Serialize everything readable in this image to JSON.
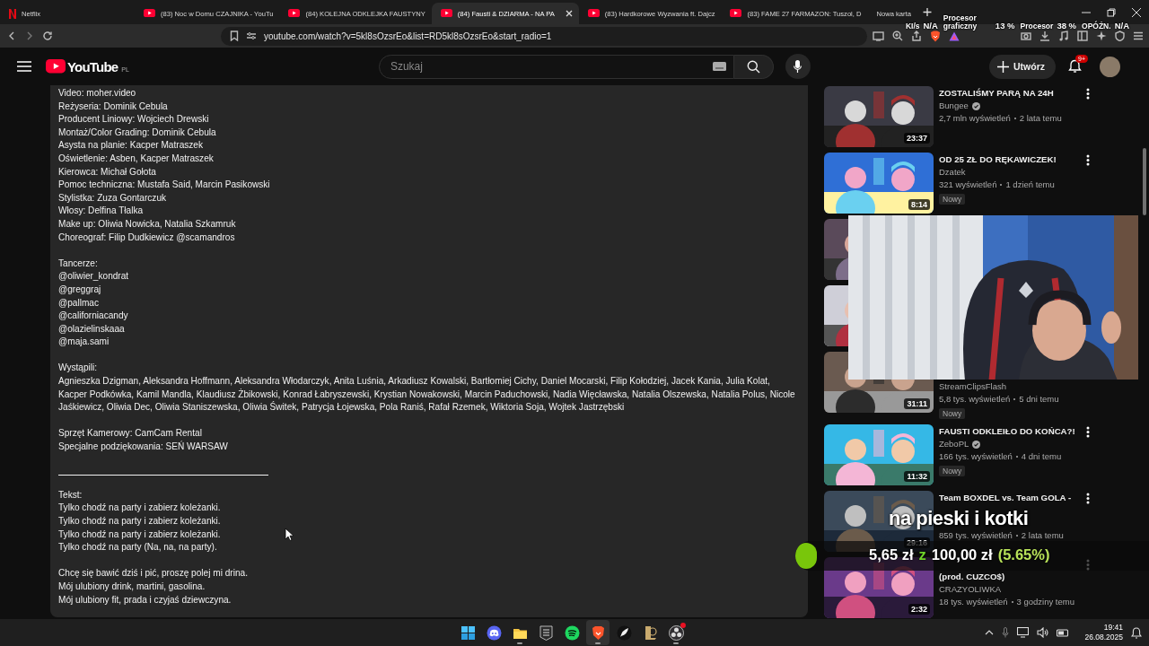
{
  "browser": {
    "tabs": [
      {
        "kind": "netflix",
        "title": "Netflix",
        "selected": false
      },
      {
        "kind": "youtube",
        "title": "(83) Noc w Domu CZAJNIKA - YouTu",
        "selected": false
      },
      {
        "kind": "youtube",
        "title": "(84) KOLEJNA ODKLEJKA FAUSTYNY",
        "selected": false
      },
      {
        "kind": "youtube",
        "title": "(84) Fausti & DZIARMA - NA PA",
        "selected": true
      },
      {
        "kind": "youtube",
        "title": "(83) Hardkorowe Wyzwania ft. Dajcz",
        "selected": false
      },
      {
        "kind": "youtube",
        "title": "(83) FAME 27 FARMAZON: Tuszol, D",
        "selected": false
      },
      {
        "kind": "blank",
        "title": "Nowa karta",
        "selected": false
      }
    ],
    "url": "youtube.com/watch?v=5kl8sOzsrEo&list=RD5kl8sOzsrEo&start_radio=1"
  },
  "performance_overlay": [
    {
      "label": "KI/s",
      "value": "N/A"
    },
    {
      "label": "Procesor graficzny",
      "value": "13 %"
    },
    {
      "label": "Procesor",
      "value": "38 %"
    },
    {
      "label": "OPÓŹN.",
      "value": "N/A"
    }
  ],
  "header": {
    "logo": "YouTube",
    "region": "PL",
    "search": {
      "placeholder": "Szukaj"
    },
    "create_button": "Utwórz",
    "notifications_badge": "9+"
  },
  "description": [
    {
      "kind": "text",
      "lines": [
        "Video: moher.video",
        "Reżyseria: Dominik Cebula",
        "Producent Liniowy: Wojciech Drewski",
        "Montaż/Color Grading: Dominik Cebula",
        "Asysta na planie: Kacper Matraszek",
        "Oświetlenie: Asben, Kacper Matraszek",
        "Kierowca: Michał Gołota",
        "Pomoc techniczna: Mustafa Said, Marcin Pasikowski",
        "Stylistka: Zuza Gontarczuk",
        "Włosy: Delfina Tłalka",
        "Make up: Oliwia Nowicka, Natalia Szkamruk",
        "Choreograf: Filip Dudkiewicz @scamandros"
      ]
    },
    {
      "kind": "text",
      "lines": [
        "Tancerze:",
        "@oliwier_kondrat",
        "@greggraj",
        "@pallmac",
        "@californiacandy",
        "@olazielinskaaa",
        "@maja.sami"
      ]
    },
    {
      "kind": "text",
      "lines": [
        "Wystąpili:",
        "Agnieszka Dzigman, Aleksandra Hoffmann, Aleksandra Włodarczyk, Anita Luśnia, Arkadiusz Kowalski, Bartłomiej Cichy, Daniel Mocarski, Filip Kołodziej, Jacek Kania, Julia Kolat,",
        "Kacper Podkówka, Kamil Mandla, Klaudiusz Żbikowski, Konrad Łabryszewski, Krystian Nowakowski, Marcin Paduchowski, Nadia Więcławska, Natalia Olszewska, Natalia Polus, Nicole",
        "Jaśkiewicz, Oliwia Dec, Oliwia Staniszewska, Oliwia Świtek, Patrycja Łojewska, Pola Raniś, Rafał Rzemek, Wiktoria Soja, Wojtek Jastrzębski"
      ]
    },
    {
      "kind": "text",
      "lines": [
        "Sprzęt Kamerowy: CamCam Rental",
        "Specjalne podziękowania: SEŃ WARSAW"
      ]
    },
    {
      "kind": "rule"
    },
    {
      "kind": "text",
      "lines": [
        "Tekst:",
        "Tylko chodź na party i zabierz koleżanki.",
        "Tylko chodź na party i zabierz koleżanki.",
        "Tylko chodź na party i zabierz koleżanki.",
        "Tylko chodź na party (Na, na, na party)."
      ]
    },
    {
      "kind": "text",
      "lines": [
        "Chcę się bawić dziś i pić, proszę polej mi drina.",
        "Mój ulubiony drink, martini, gasolina.",
        "Mój ulubiony fit, prada i czyjaś dziewczyna."
      ]
    }
  ],
  "recommendations": [
    {
      "title": "ZOSTALIŚMY PARĄ NA 24H",
      "kind": "plain",
      "channel": "Bungee",
      "verified": true,
      "views": "2,7 mln wyświetleń",
      "age": "2 lata temu",
      "duration": "23:37",
      "menu": true
    },
    {
      "title": "OD 25 ZŁ DO RĘKAWICZEK!",
      "kind": "plain",
      "channel": "Dzatek",
      "verified": false,
      "views": "321 wyświetleń",
      "age": "1 dzień temu",
      "badge": "Nowy",
      "duration": "8:14",
      "menu": true
    },
    {
      "kind": "covered",
      "verified": false,
      "menu": false
    },
    {
      "kind": "covered",
      "verified": false,
      "menu": false
    },
    {
      "kind": "covered",
      "channel": "StreamClipsFlash",
      "verified": false,
      "views": "5,8 tys. wyświetleń",
      "age": "5 dni temu",
      "badge": "Nowy",
      "duration": "31:11",
      "menu": false
    },
    {
      "title": "FAUSTI ODKLEIŁO DO KOŃCA?!",
      "kind": "plain",
      "channel": "ZeboPL",
      "verified": true,
      "views": "166 tys. wyświetleń",
      "age": "4 dni temu",
      "badge": "Nowy",
      "duration": "11:32",
      "menu": true
    },
    {
      "title": "Team BOXDEL vs. Team GOLA -",
      "kind": "halfcovered_below",
      "verified": false,
      "views": "859 tys. wyświetleń",
      "age": "2 lata temu",
      "duration": "29:16",
      "menu": true
    },
    {
      "title": "(prod. CUZCO$)",
      "kind": "halfcovered",
      "channel": "CRAZYOLIWKA",
      "verified": false,
      "views": "18 tys. wyświetleń",
      "age": "3 godziny temu",
      "duration": "2:32",
      "menu": true
    }
  ],
  "stream_overlay": {
    "goal_title": "na pieski i kotki",
    "goal_current": "5,65 zł",
    "goal_separator": "z",
    "goal_target": "100,00 zł",
    "goal_percent": "(5.65%)",
    "level": 0.0565
  },
  "taskbar": {
    "apps": [
      {
        "kind": "start",
        "running": false,
        "selected": false
      },
      {
        "kind": "discord",
        "running": false,
        "selected": false
      },
      {
        "kind": "files",
        "running": true,
        "selected": false
      },
      {
        "kind": "epic",
        "running": false,
        "selected": false
      },
      {
        "kind": "spotify",
        "running": false,
        "selected": false
      },
      {
        "kind": "brave",
        "running": true,
        "selected": true
      },
      {
        "kind": "feather",
        "running": false,
        "selected": false
      },
      {
        "kind": "league",
        "running": false,
        "selected": false
      },
      {
        "kind": "obs",
        "running": true,
        "selected": false
      }
    ],
    "time": "19:41",
    "date": "26.08.2025"
  }
}
